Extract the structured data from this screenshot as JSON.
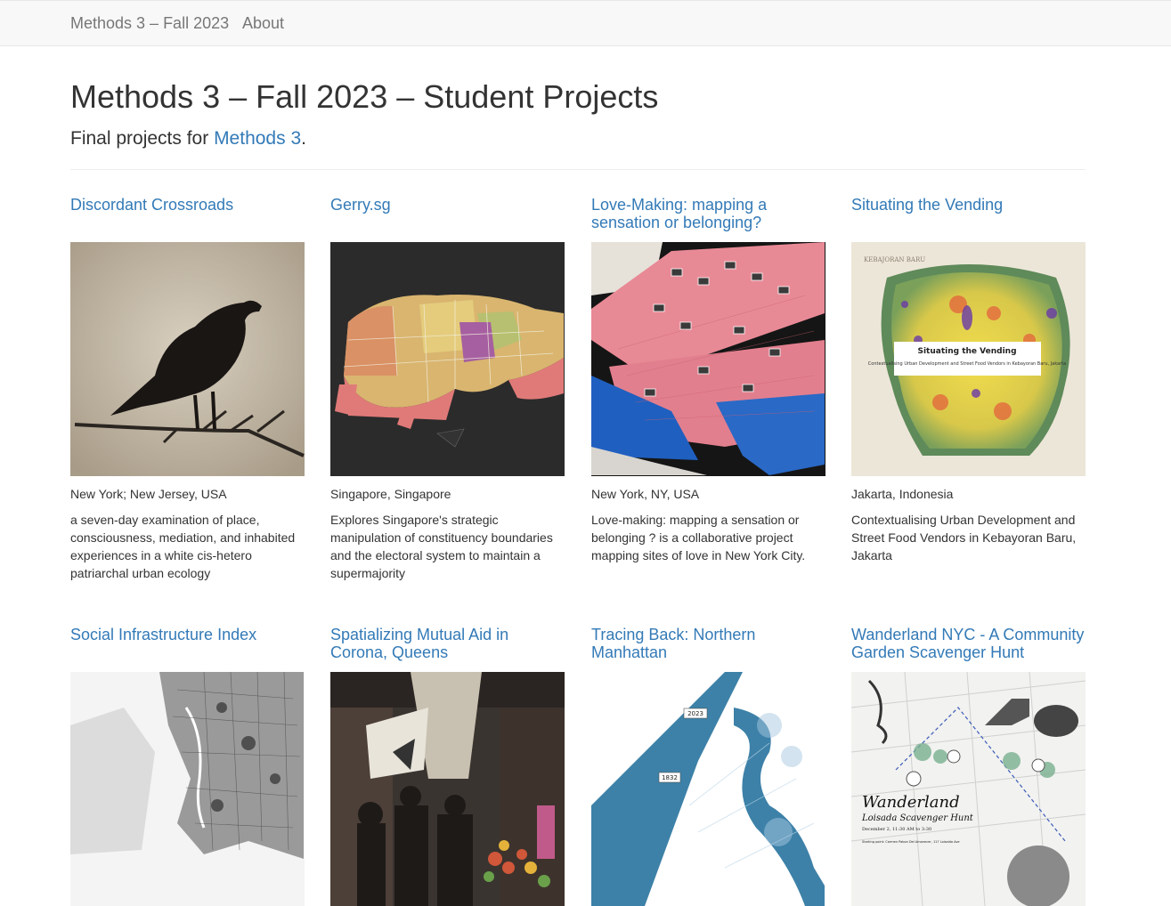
{
  "nav": {
    "brand": "Methods 3 – Fall 2023",
    "about": "About"
  },
  "header": {
    "title": "Methods 3 – Fall 2023 – Student Projects",
    "subtitle_prefix": "Final projects for ",
    "subtitle_link": "Methods 3",
    "subtitle_suffix": "."
  },
  "projects": [
    {
      "title": "Discordant Crossroads",
      "location": "New York; New Jersey, USA",
      "description": "a seven-day examination of place, consciousness, mediation, and inhabited experiences in a white cis-hetero patriarchal urban ecology"
    },
    {
      "title": "Gerry.sg",
      "location": "Singapore, Singapore",
      "description": "Explores Singapore's strategic manipulation of constituency boundaries and the electoral system to maintain a supermajority"
    },
    {
      "title": "Love-Making: mapping a sensation or belonging?",
      "location": "New York, NY, USA",
      "description": "Love-making: mapping a sensation or belonging ? is a collaborative project mapping sites of love in New York City."
    },
    {
      "title": "Situating the Vending",
      "location": "Jakarta, Indonesia",
      "description": "Contextualising Urban Development and Street Food Vendors in Kebayoran Baru, Jakarta",
      "image_text": {
        "map_caption_title": "Situating the Vending",
        "map_caption_sub": "Contextualising Urban Development and Street Food Vendors in Kebayoran Baru, Jakarta",
        "map_header": "KEBAJORAN BARU"
      }
    },
    {
      "title": "Social Infrastructure Index"
    },
    {
      "title": "Spatializing Mutual Aid in Corona, Queens"
    },
    {
      "title": "Tracing Back: Northern Manhattan",
      "image_text": {
        "label_2023": "2023",
        "label_1832": "1832"
      }
    },
    {
      "title": "Wanderland NYC - A Community Garden Scavenger Hunt",
      "image_text": {
        "poster_title": "Wanderland",
        "poster_subtitle": "Loisada Scavenger Hunt",
        "poster_date": "December 2, 11:30 AM to 3:30",
        "poster_start": "Starting point: Carmen Pabon Del Amanecer, 117 Loisaida Ave"
      }
    }
  ]
}
